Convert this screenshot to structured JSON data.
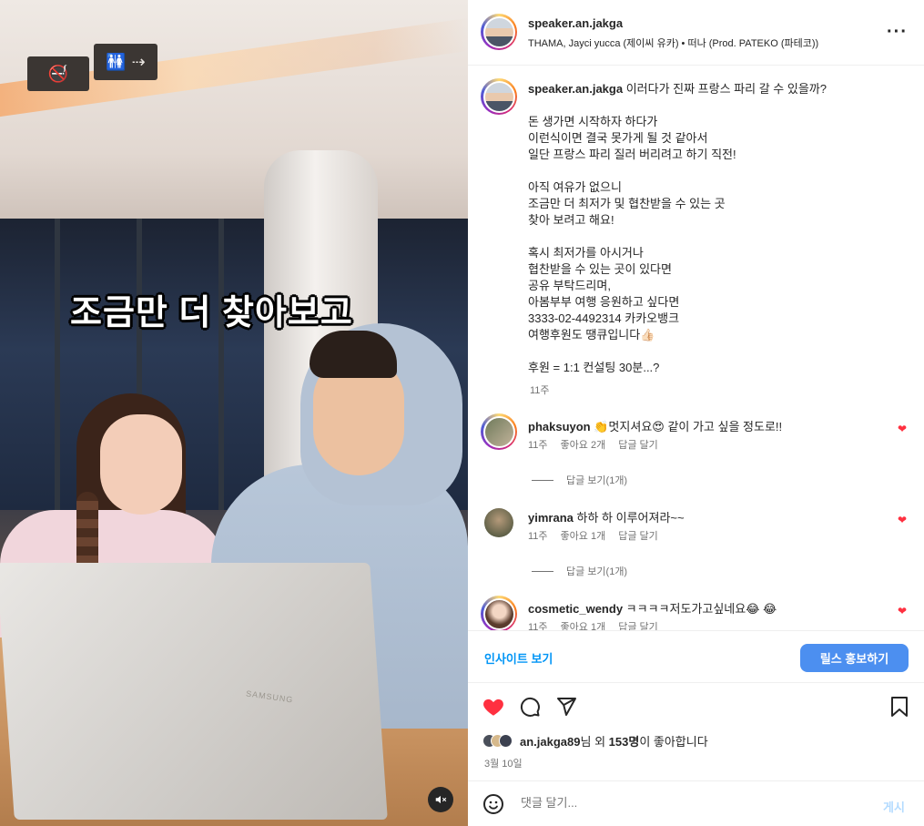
{
  "media": {
    "caption_overlay": "조금만 더 찾아보고",
    "laptop_brand": "SAMSUNG",
    "sign_text": "⇢"
  },
  "header": {
    "username": "speaker.an.jakga",
    "audio": "THAMA, Jayci yucca (제이씨 유카) • 떠나 (Prod. PATEKO (파테코))",
    "more_icon": "more-horizontal-icon"
  },
  "caption": {
    "username": "speaker.an.jakga",
    "text": "이러다가 진짜 프랑스 파리 갈 수 있을까?\n\n돈 생가면 시작하자 하다가\n이런식이면 결국 못가게 될 것 같아서\n일단 프랑스 파리 질러 버리려고 하기 직전!\n\n아직 여유가 없으니\n조금만 더 최저가 및 협찬받을 수 있는 곳\n찾아 보려고 해요!\n\n혹시 최저가를 아시거나\n협찬받을 수 있는 곳이 있다면\n공유 부탁드리며,\n아봄부부 여행 응원하고 싶다면\n3333-02-4492314 카카오뱅크\n여행후원도 땡큐입니다👍🏻\n\n후원 = 1:1 컨설팅 30분...?",
    "time": "11주"
  },
  "comments": [
    {
      "username": "phaksuyon",
      "text": "👏멋지셔요😍 같이 가고 싶을 정도로!!",
      "time": "11주",
      "likes": "좋아요 2개",
      "reply": "답글 달기",
      "view_replies": "답글 보기(1개)"
    },
    {
      "username": "yimrana",
      "text": "하하 하 이루어져라~~",
      "time": "11주",
      "likes": "좋아요 1개",
      "reply": "답글 달기",
      "view_replies": "답글 보기(1개)"
    },
    {
      "username": "cosmetic_wendy",
      "text": "ㅋㅋㅋㅋ저도가고싶네요😂 😂",
      "time": "11주",
      "likes": "좋아요 1개",
      "reply": "답글 달기"
    }
  ],
  "actions": {
    "insights": "인사이트 보기",
    "promote": "릴스 홍보하기"
  },
  "likes": {
    "user": "an.jakga89",
    "suffix1": "님 외 ",
    "count": "153명",
    "suffix2": "이 좋아합니다"
  },
  "date": "3월 10일",
  "add_comment": {
    "placeholder": "댓글 달기...",
    "post": "게시"
  },
  "colors": {
    "like_red": "#ff3040",
    "link_blue": "#0095f6",
    "promote_blue": "#4c8ff0"
  }
}
